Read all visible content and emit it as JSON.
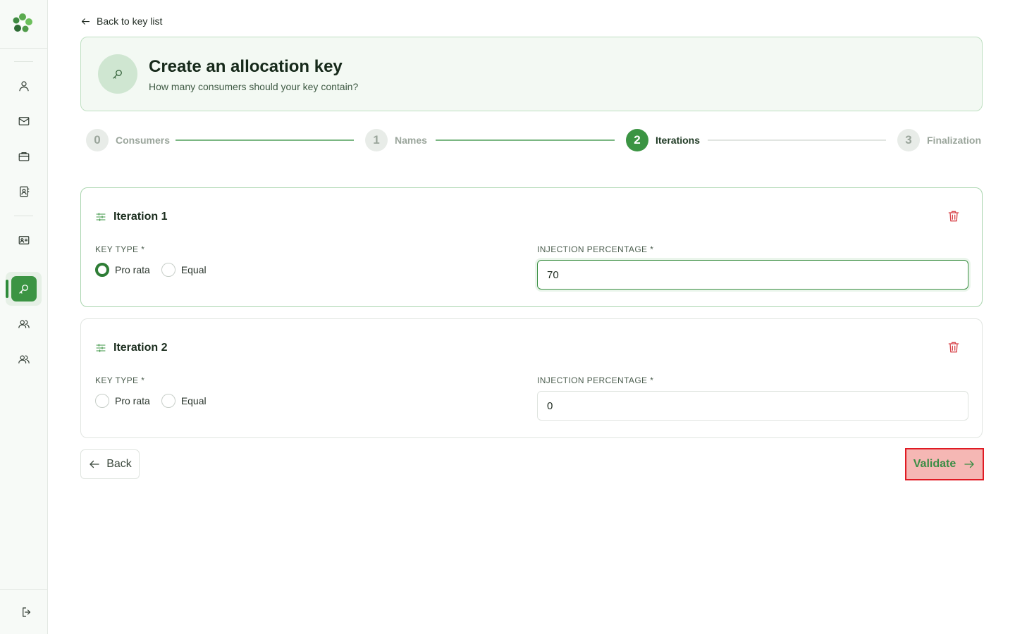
{
  "sidebar": {
    "logo": "clover-logo",
    "items": [
      {
        "icon": "user-icon",
        "name": "nav-users"
      },
      {
        "icon": "mail-icon",
        "name": "nav-messages"
      },
      {
        "icon": "briefcase-icon",
        "name": "nav-projects"
      },
      {
        "icon": "contact-book-icon",
        "name": "nav-contacts"
      },
      {
        "icon": "id-card-icon",
        "name": "nav-identity"
      },
      {
        "icon": "key-icon",
        "name": "nav-allocation-keys",
        "active": true
      },
      {
        "icon": "group-icon",
        "name": "nav-consumers"
      },
      {
        "icon": "group-icon",
        "name": "nav-producers"
      }
    ],
    "logout_icon": "logout-icon"
  },
  "back_link": {
    "label": "Back to key list"
  },
  "header": {
    "title": "Create an allocation key",
    "subtitle": "How many consumers should your key contain?",
    "icon": "key-icon"
  },
  "stepper": {
    "steps": [
      {
        "number": "0",
        "label": "Consumers",
        "state": "done"
      },
      {
        "number": "1",
        "label": "Names",
        "state": "done"
      },
      {
        "number": "2",
        "label": "Iterations",
        "state": "active"
      },
      {
        "number": "3",
        "label": "Finalization",
        "state": "todo"
      }
    ]
  },
  "iterations": [
    {
      "title": "Iteration 1",
      "key_type_label": "KEY TYPE *",
      "options": [
        "Pro rata",
        "Equal"
      ],
      "selected": "Pro rata",
      "percentage_label": "INJECTION PERCENTAGE *",
      "percentage_value": "70"
    },
    {
      "title": "Iteration 2",
      "key_type_label": "KEY TYPE *",
      "options": [
        "Pro rata",
        "Equal"
      ],
      "selected": null,
      "percentage_label": "INJECTION PERCENTAGE *",
      "percentage_value": "0"
    }
  ],
  "footer": {
    "back_label": "Back",
    "validate_label": "Validate"
  },
  "colors": {
    "accent": "#3b9443",
    "danger": "#d8434a",
    "highlight_bg": "#f5b7b4",
    "highlight_border": "#e01b24"
  }
}
